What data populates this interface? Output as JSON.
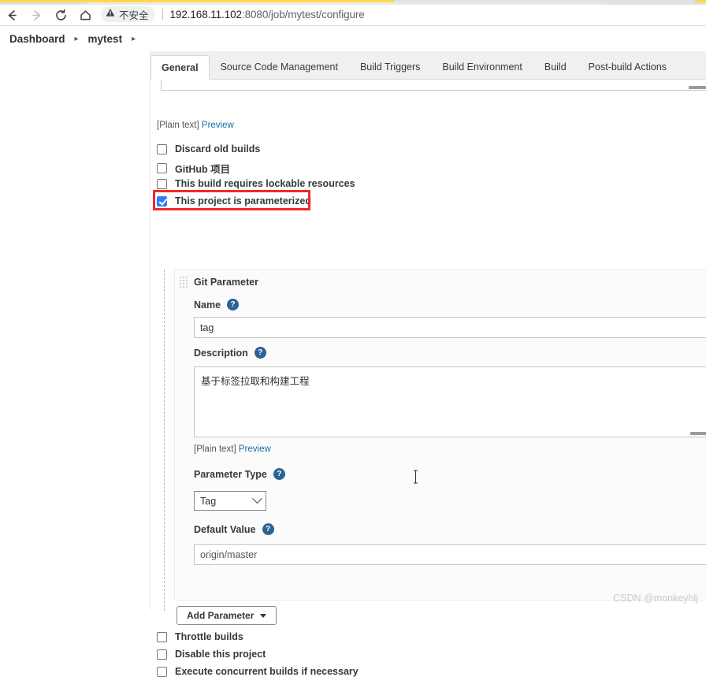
{
  "browser": {
    "nav": {
      "back": "back-arrow",
      "forward": "forward-arrow",
      "reload": "reload",
      "home": "home"
    },
    "security_label": "不安全",
    "url_host": "192.168.11.102",
    "url_rest": ":8080/job/mytest/configure"
  },
  "breadcrumb": {
    "items": [
      "Dashboard",
      "mytest"
    ],
    "separator": "▸"
  },
  "tabs": [
    {
      "label": "General",
      "active": true
    },
    {
      "label": "Source Code Management",
      "active": false
    },
    {
      "label": "Build Triggers",
      "active": false
    },
    {
      "label": "Build Environment",
      "active": false
    },
    {
      "label": "Build",
      "active": false
    },
    {
      "label": "Post-build Actions",
      "active": false
    }
  ],
  "form": {
    "plain_text_note": "[Plain text]",
    "preview_link": "Preview",
    "checkboxes_top": [
      {
        "label": "Discard old builds",
        "checked": false
      },
      {
        "label": "GitHub 项目",
        "checked": false
      },
      {
        "label": "This build requires lockable resources",
        "checked": false
      },
      {
        "label": "This project is parameterized",
        "checked": true,
        "highlighted": true
      }
    ],
    "checkboxes_bottom": [
      {
        "label": "Throttle builds",
        "checked": false
      },
      {
        "label": "Disable this project",
        "checked": false
      },
      {
        "label": "Execute concurrent builds if necessary",
        "checked": false
      }
    ],
    "add_parameter_button": "Add Parameter"
  },
  "parameter": {
    "title": "Git Parameter",
    "name_label": "Name",
    "name_value": "tag",
    "description_label": "Description",
    "description_value": "基于标签拉取和构建工程",
    "description_plain_text": "[Plain text]",
    "description_preview": "Preview",
    "type_label": "Parameter Type",
    "type_value": "Tag",
    "default_label": "Default Value",
    "default_value": "origin/master",
    "help_glyph": "?"
  },
  "watermark": "CSDN @monkeyhlj",
  "colors": {
    "accent_blue": "#2a6496",
    "highlight_red": "#ef2b2b",
    "checkbox_blue": "#2d7ff9",
    "tab_yellow": "#fcd94b"
  }
}
